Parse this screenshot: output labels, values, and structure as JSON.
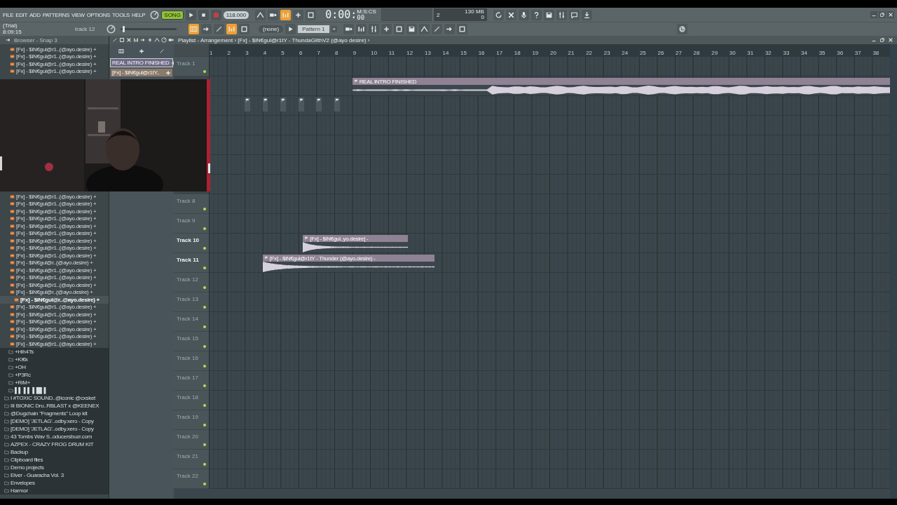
{
  "menu": [
    "FILE",
    "EDIT",
    "ADD",
    "PATTERNS",
    "VIEW",
    "OPTIONS",
    "TOOLS",
    "HELP"
  ],
  "info": {
    "license": "(Trial)",
    "clock": "8:09:15",
    "hint": "track 12"
  },
  "transport": {
    "mode": "SONG",
    "song_mode": true,
    "tempo": "118.000"
  },
  "master_volume": {
    "level": 0.04
  },
  "time": {
    "value": "0:00",
    "separator": ":",
    "fraction": "00",
    "unit": "M:S:CS"
  },
  "cpu": {
    "value": "2",
    "memory": "130 MB",
    "polyphony": "0"
  },
  "tool_buttons_top": [
    {
      "on": false
    },
    {
      "on": false
    },
    {
      "on": true
    },
    {
      "on": false
    },
    {
      "on": false
    }
  ],
  "tool_buttons_bottom": [
    {
      "on": true
    },
    {
      "on": false
    },
    {
      "on": false
    },
    {
      "on": true
    },
    {
      "on": false
    }
  ],
  "pattern": {
    "channel": "(none)",
    "name": "Pattern 1",
    "add": "+"
  },
  "browser": {
    "title": "Browser - Snap 3",
    "top_items": [
      {
        "kind": "file",
        "label": "[Fx] - $iN€gul@r1..(@ayo.desire) +",
        "selected": false
      },
      {
        "kind": "file",
        "label": "[Fx] - $iN€gul@r1..(@ayo.desire) +",
        "selected": false
      },
      {
        "kind": "file",
        "label": "[Fx] - $iN€gul@r1..(@ayo.desire) +",
        "selected": false
      },
      {
        "kind": "file",
        "label": "[Fx] - $iN€gul@r1..(@ayo.desire) +",
        "selected": false
      }
    ],
    "items": [
      {
        "kind": "file",
        "label": "[Fx] - $iN€gul@r1..(@ayo.desire) +",
        "selected": false
      },
      {
        "kind": "file",
        "label": "[Fx] - $iN€gul@r1..(@ayo.desire) +",
        "selected": false
      },
      {
        "kind": "file",
        "label": "[Fx] - $iN€gul@r1..(@ayo.desire) +",
        "selected": false
      },
      {
        "kind": "file",
        "label": "[Fx] - $iN€gul@r1..(@ayo.desire) +",
        "selected": false
      },
      {
        "kind": "file",
        "label": "[Fx] - $iN€gul@r1..(@ayo.desire) +",
        "selected": false
      },
      {
        "kind": "file",
        "label": "[Fx] - $iN€gul@r1..(@ayo.desire) +",
        "selected": false
      },
      {
        "kind": "file",
        "label": "[Fx] - $iN€gul@r1..(@ayo.desire) +",
        "selected": false
      },
      {
        "kind": "file",
        "label": "[Fx] - $iN€gul@r1..(@ayo.desire) +",
        "selected": false
      },
      {
        "kind": "file",
        "label": "[Fx] - $iN€gul@r1..(@ayo.desire) +",
        "selected": false
      },
      {
        "kind": "file",
        "label": "[Fx] - $iN€gul@r..(@ayo.desire) +",
        "selected": false
      },
      {
        "kind": "file",
        "label": "[Fx] - $iN€gul@r1..(@ayo.desire) +",
        "selected": false
      },
      {
        "kind": "file",
        "label": "[Fx] - $iN€gul@r1..(@ayo.desire) +",
        "selected": false
      },
      {
        "kind": "file",
        "label": "[Fx] - $iN€gul@r1..(@ayo.desire) +",
        "selected": false
      },
      {
        "kind": "file",
        "label": "[Fx] - $iN€gul@r..(@ayo.desire) +",
        "selected": false
      },
      {
        "kind": "file",
        "label": "[Fx] - $iN€gul@r..@ayo.desire) +",
        "selected": true
      },
      {
        "kind": "file",
        "label": "[Fx] - $iN€gul@r1..(@ayo.desire) +",
        "selected": false
      },
      {
        "kind": "file",
        "label": "[Fx] - $iN€gul@r1..(@ayo.desire) +",
        "selected": false
      },
      {
        "kind": "file",
        "label": "[Fx] - $iN€gul@r1..(@ayo.desire) +",
        "selected": false
      },
      {
        "kind": "file",
        "label": "[Fx] - $iN€gul@r1..(@ayo.desire) +",
        "selected": false
      },
      {
        "kind": "file",
        "label": "[Fx] - $iN€gul@r1..(@ayo.desire) +",
        "selected": false
      },
      {
        "kind": "file",
        "label": "[Fx] - $iN€gul@r1..(@ayo.desire) +",
        "selected": false
      },
      {
        "kind": "subfolder",
        "label": "+Hih4Ts",
        "selected": false
      },
      {
        "kind": "subfolder",
        "label": "+Ki€k",
        "selected": false
      },
      {
        "kind": "subfolder",
        "label": "+OH",
        "selected": false
      },
      {
        "kind": "subfolder",
        "label": "+P3Rc",
        "selected": false
      },
      {
        "kind": "subfolder",
        "label": "+RiM+",
        "selected": false
      },
      {
        "kind": "subfolder",
        "label": "▌▌ ▌▌ ▌█▌▌",
        "selected": false
      },
      {
        "kind": "folder",
        "label": "I #TOXIC SOUND..@iconic @cxsket",
        "selected": false
      },
      {
        "kind": "folder",
        "label": "III BIONIC Dru..RBLAST x @KEENEX",
        "selected": false
      },
      {
        "kind": "folder",
        "label": "@Dugchain \"Fragments\" Loop kit",
        "selected": false
      },
      {
        "kind": "folder",
        "label": "[DEMO] 'JETLAG'..odby.xero - Copy",
        "selected": false
      },
      {
        "kind": "folder",
        "label": "[DEMO] 'JETLAG'..odby.xero - Copy",
        "selected": false
      },
      {
        "kind": "folder",
        "label": "43 Tombs Wav S..oducersbuzr.com",
        "selected": false
      },
      {
        "kind": "folder",
        "label": "AZPEX - CRAZY FROG DRUM KIT",
        "selected": false
      },
      {
        "kind": "folder",
        "label": "Backup",
        "selected": false
      },
      {
        "kind": "folder",
        "label": "Clipboard files",
        "selected": false
      },
      {
        "kind": "folder",
        "label": "Demo projects",
        "selected": false
      },
      {
        "kind": "folder",
        "label": "Elver - Guaracha Vol. 3",
        "selected": false
      },
      {
        "kind": "folder",
        "label": "Envelopes",
        "selected": false
      },
      {
        "kind": "folder",
        "label": "Harmor",
        "selected": false
      }
    ]
  },
  "playlist": {
    "title": "Playlist - Arrangement › [Fx] - $iN€gul@r1tY - ThundaGlithV2 (@ayo desire) ›",
    "picker": [
      {
        "name": "REAL INTRO FINISHED",
        "selected": true
      },
      {
        "name": "[Fx] - $iN€gul@r1tY..",
        "selected": false
      }
    ],
    "ruler": [
      "1",
      "2",
      "3",
      "4",
      "5",
      "6",
      "7",
      "8",
      "9",
      "10",
      "11",
      "12",
      "13",
      "14",
      "15",
      "16",
      "17",
      "18",
      "19",
      "20",
      "21",
      "22",
      "23",
      "24",
      "25",
      "26",
      "27",
      "28",
      "29",
      "30",
      "31",
      "32",
      "33",
      "34",
      "35",
      "36",
      "37",
      "38"
    ],
    "tracks": [
      {
        "label": "Track 1",
        "active": false,
        "on": true
      },
      {
        "clips": [
          {
            "kind": "swell",
            "name": "REAL INTRO FINISHED"
          }
        ]
      },
      {
        "clips": [
          {
            "kind": "marker"
          },
          {
            "kind": "marker"
          },
          {
            "kind": "marker"
          },
          {
            "kind": "marker"
          },
          {
            "kind": "marker"
          },
          {
            "kind": "marker"
          }
        ]
      },
      {
        "label": "Track 8",
        "active": false,
        "on": true
      },
      {
        "label": "Track 9",
        "active": false,
        "on": true
      },
      {
        "label": "Track 10",
        "active": true,
        "on": true,
        "clips": [
          {
            "kind": "hit",
            "name": "[Fx] - $iN€gul..yo.desire] -"
          }
        ]
      },
      {
        "label": "Track 11",
        "active": true,
        "on": true,
        "clips": [
          {
            "kind": "hit",
            "name": "[Fx] - $iN€gul@r1tY - Thunder (@ayo.desire) -"
          }
        ]
      },
      {
        "label": "Track 12",
        "active": false,
        "on": true
      },
      {
        "label": "Track 13",
        "active": false,
        "on": true
      },
      {
        "label": "Track 14",
        "active": false,
        "on": true
      },
      {
        "label": "Track 15",
        "active": false,
        "on": true
      },
      {
        "label": "Track 16",
        "active": false,
        "on": true
      },
      {
        "label": "Track 17",
        "active": false,
        "on": true
      },
      {
        "label": "Track 18",
        "active": false,
        "on": true
      },
      {
        "label": "Track 19",
        "active": false,
        "on": true
      },
      {
        "label": "Track 20",
        "active": false,
        "on": true
      },
      {
        "label": "Track 21",
        "active": false,
        "on": true
      },
      {
        "label": "Track 22",
        "active": false,
        "on": true
      }
    ]
  }
}
